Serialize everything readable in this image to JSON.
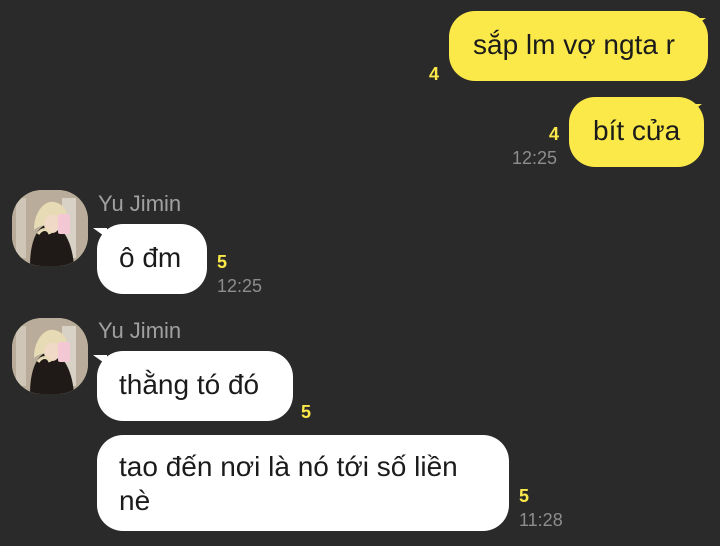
{
  "messages": [
    {
      "direction": "out",
      "text": "sắp lm vợ ngta r",
      "unread": "4"
    },
    {
      "direction": "out",
      "text": "bít cửa",
      "unread": "4",
      "time": "12:25"
    },
    {
      "direction": "in",
      "sender": "Yu Jimin",
      "text": "ô đm",
      "unread": "5",
      "time": "12:25"
    },
    {
      "direction": "in",
      "sender": "Yu Jimin",
      "text": "thằng tó đó",
      "unread": "5"
    },
    {
      "direction": "in",
      "text": "tao đến nơi là nó tới số liền nè",
      "unread": "5",
      "time": "11:28"
    }
  ],
  "colors": {
    "background": "#2a2a2a",
    "outgoing_bubble": "#fbe94a",
    "incoming_bubble": "#ffffff",
    "unread_count": "#fbe94a",
    "timestamp": "#8d8d8d",
    "sender_name": "#a0a0a0"
  },
  "icons": {
    "avatar": "profile-photo-avatar"
  }
}
